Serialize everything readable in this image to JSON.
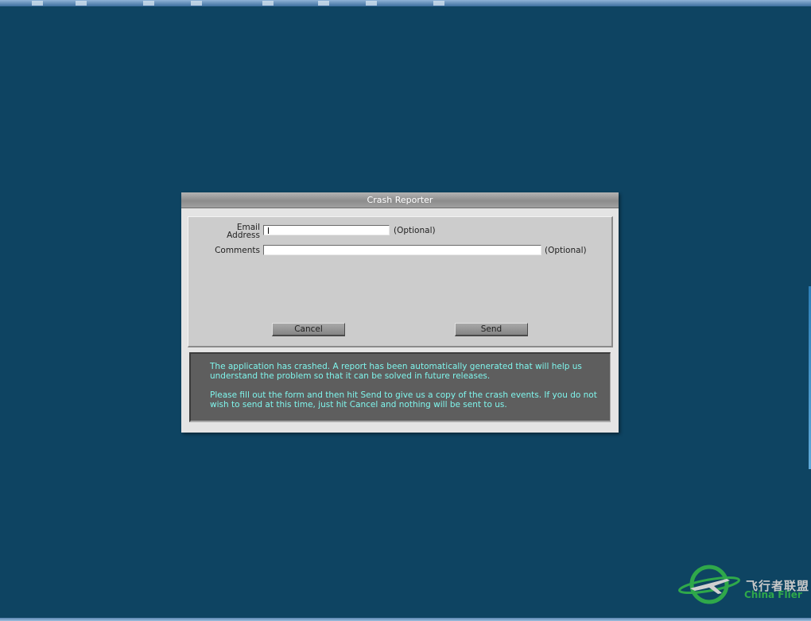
{
  "dialog": {
    "title": "Crash Reporter",
    "form": {
      "email_label": "Email Address",
      "email_value": "",
      "email_note": "(Optional)",
      "comments_label": "Comments",
      "comments_value": "",
      "comments_note": "(Optional)"
    },
    "buttons": {
      "cancel": "Cancel",
      "send": "Send"
    },
    "message": {
      "paragraph1": "The application has crashed. A report has been automatically generated that will help us understand the problem so that it can be solved in future releases.",
      "paragraph2": "Please fill out the form and then hit Send to give us a copy of the crash events. If you do not wish to send at this time, just hit Cancel and nothing will be sent to us."
    }
  },
  "watermark": {
    "chinese": "飞行者联盟",
    "english": "China Flier"
  },
  "colors": {
    "desktop_bg": "#0e4462",
    "message_text": "#7ff5ec",
    "message_bg": "#5e5e5e",
    "watermark_green": "#2fa84a"
  }
}
